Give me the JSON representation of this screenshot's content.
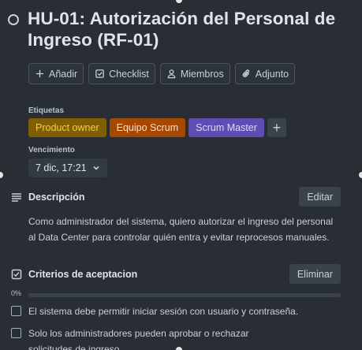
{
  "card": {
    "title": "HU-01: Autorización del Personal de Ingreso (RF-01)"
  },
  "actions": [
    {
      "label": "Añadir",
      "icon": "plus-icon"
    },
    {
      "label": "Checklist",
      "icon": "checklist-icon"
    },
    {
      "label": "Miembros",
      "icon": "person-icon"
    },
    {
      "label": "Adjunto",
      "icon": "paperclip-icon"
    }
  ],
  "labels_section": {
    "heading": "Etiquetas",
    "items": [
      {
        "text": "Product owner",
        "bg": "#7f5f01",
        "color": "#f5cd47"
      },
      {
        "text": "Equipo Scrum",
        "bg": "#a54800",
        "color": "#fedec8"
      },
      {
        "text": "Scrum Master",
        "bg": "#5e4db2",
        "color": "#dfd8fd"
      }
    ],
    "add_symbol": "+"
  },
  "due": {
    "heading": "Vencimiento",
    "value": "7 dic, 17:21"
  },
  "description": {
    "heading": "Descripción",
    "edit_label": "Editar",
    "text": "Como administrador del sistema, quiero autorizar el ingreso del personal al Data Center para controlar quién entra y evitar reprocesos manuales."
  },
  "checklist": {
    "heading": "Criterios de aceptacion",
    "delete_label": "Eliminar",
    "progress_label": "0%",
    "progress": 0,
    "items": [
      {
        "text": "El sistema debe permitir iniciar sesión con usuario y contraseña.",
        "checked": false
      },
      {
        "text": "Solo los administradores pueden aprobar o rechazar solicitudes de ingreso.",
        "checked": false
      }
    ]
  },
  "colors": {
    "background": "#282e33",
    "text": "#c7d1db",
    "accent": "#579dff"
  }
}
